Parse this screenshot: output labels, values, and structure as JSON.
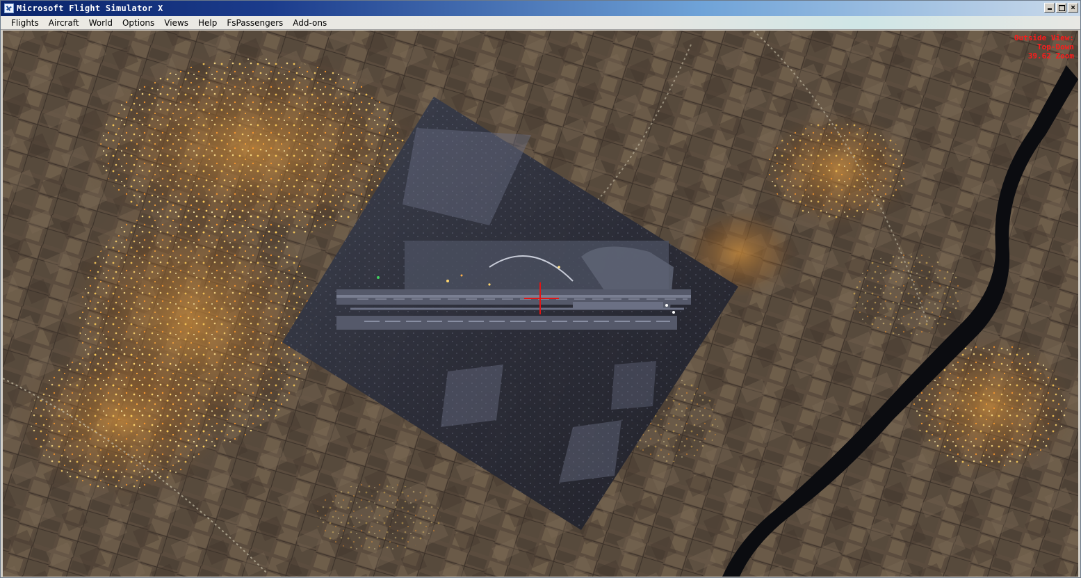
{
  "window": {
    "title": "Microsoft Flight Simulator X",
    "controls": [
      "minimize",
      "maximize",
      "close"
    ]
  },
  "menu": {
    "items": [
      "Flights",
      "Aircraft",
      "World",
      "Options",
      "Views",
      "Help",
      "FsPassengers",
      "Add-ons"
    ]
  },
  "view_overlay": {
    "line1": "Outside View:",
    "line2": "Top-Down",
    "line3": "39.62 Zoom"
  },
  "icons": {
    "app": "plane-icon",
    "crosshair": "crosshair-icon"
  },
  "colors": {
    "overlay_text": "#ff1a1a",
    "crosshair": "#e01515",
    "titlebar_start": "#0a246a",
    "titlebar_end": "#c9d9ea"
  }
}
